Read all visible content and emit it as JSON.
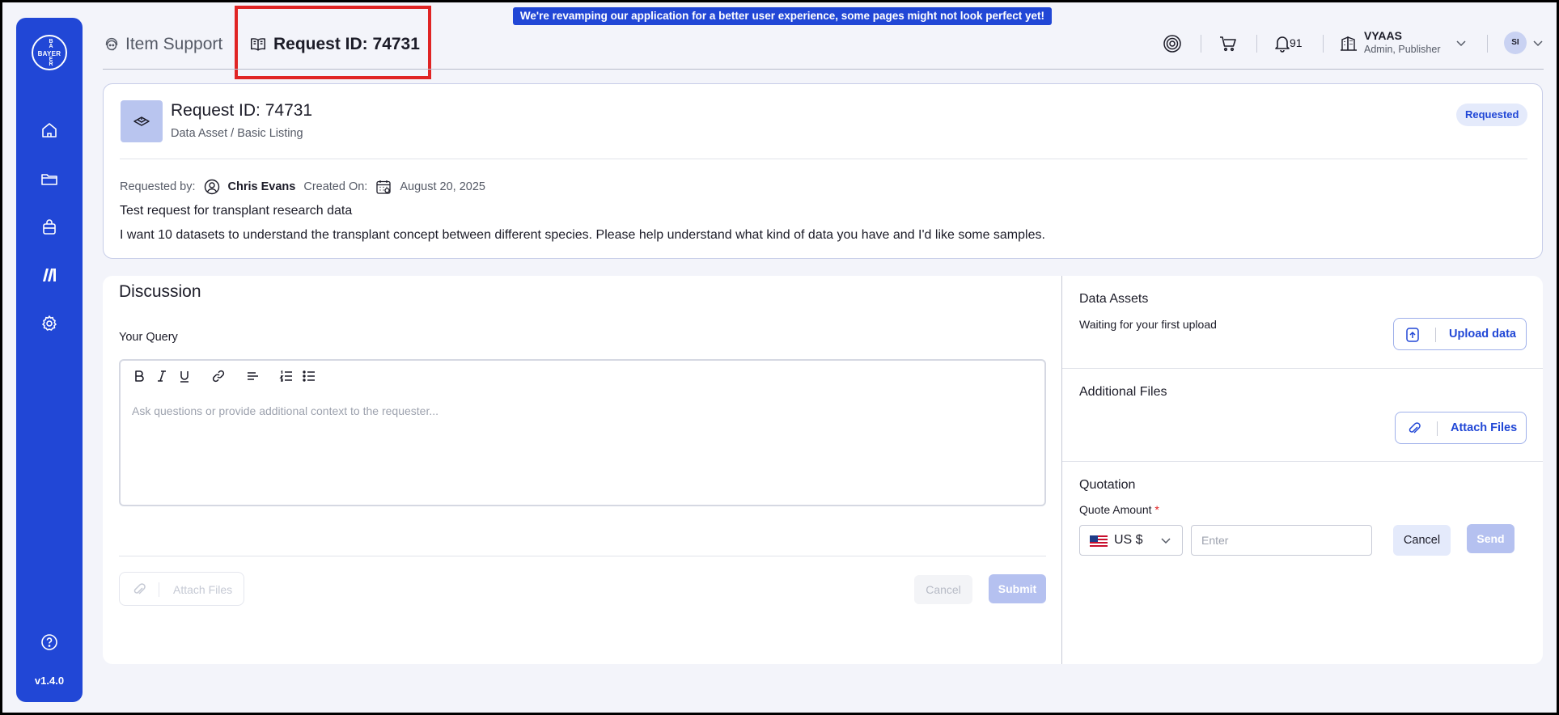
{
  "banner": {
    "text": "We're revamping our application for a better user experience, some pages might not look perfect yet!"
  },
  "sidebar": {
    "logo": {
      "horizontal": "BAYER",
      "vertical": [
        "B",
        "A",
        "Y",
        "E",
        "R"
      ]
    },
    "items": [
      {
        "icon": "home-icon"
      },
      {
        "icon": "folder-icon"
      },
      {
        "icon": "bag-icon"
      },
      {
        "icon": "brand-icon"
      },
      {
        "icon": "gear-icon"
      }
    ],
    "help_icon": "help-icon",
    "version": "v1.4.0"
  },
  "header": {
    "breadcrumb_label": "Item Support",
    "page_title": "Request ID: 74731",
    "notifications_count": "91",
    "user": {
      "name": "VYAAS",
      "role": "Admin, Publisher",
      "initials": "SI"
    }
  },
  "request": {
    "title": "Request ID: 74731",
    "subtitle": "Data Asset / Basic Listing",
    "status": "Requested",
    "requested_by_label": "Requested by:",
    "requested_by": "Chris Evans",
    "created_on_label": "Created On:",
    "created_on": "August 20, 2025",
    "headline": "Test request for transplant research data",
    "description": "I want 10 datasets to understand the transplant concept between different species. Please help understand what kind of data you have and I'd like some samples."
  },
  "discussion": {
    "title": "Discussion",
    "query_label": "Your Query",
    "placeholder": "Ask questions or provide additional context to the requester...",
    "attach_label": "Attach Files",
    "cancel_label": "Cancel",
    "submit_label": "Submit"
  },
  "data_assets": {
    "title": "Data Assets",
    "status_text": "Waiting for your first upload",
    "upload_label": "Upload data"
  },
  "additional_files": {
    "title": "Additional Files",
    "attach_label": "Attach Files"
  },
  "quotation": {
    "title": "Quotation",
    "amount_label": "Quote Amount",
    "required_mark": "*",
    "currency": "US $",
    "amount_placeholder": "Enter",
    "cancel_label": "Cancel",
    "send_label": "Send"
  },
  "colors": {
    "brand": "#2147d6",
    "highlight_box": "#e02424",
    "status_badge_bg": "#e4eafb"
  }
}
